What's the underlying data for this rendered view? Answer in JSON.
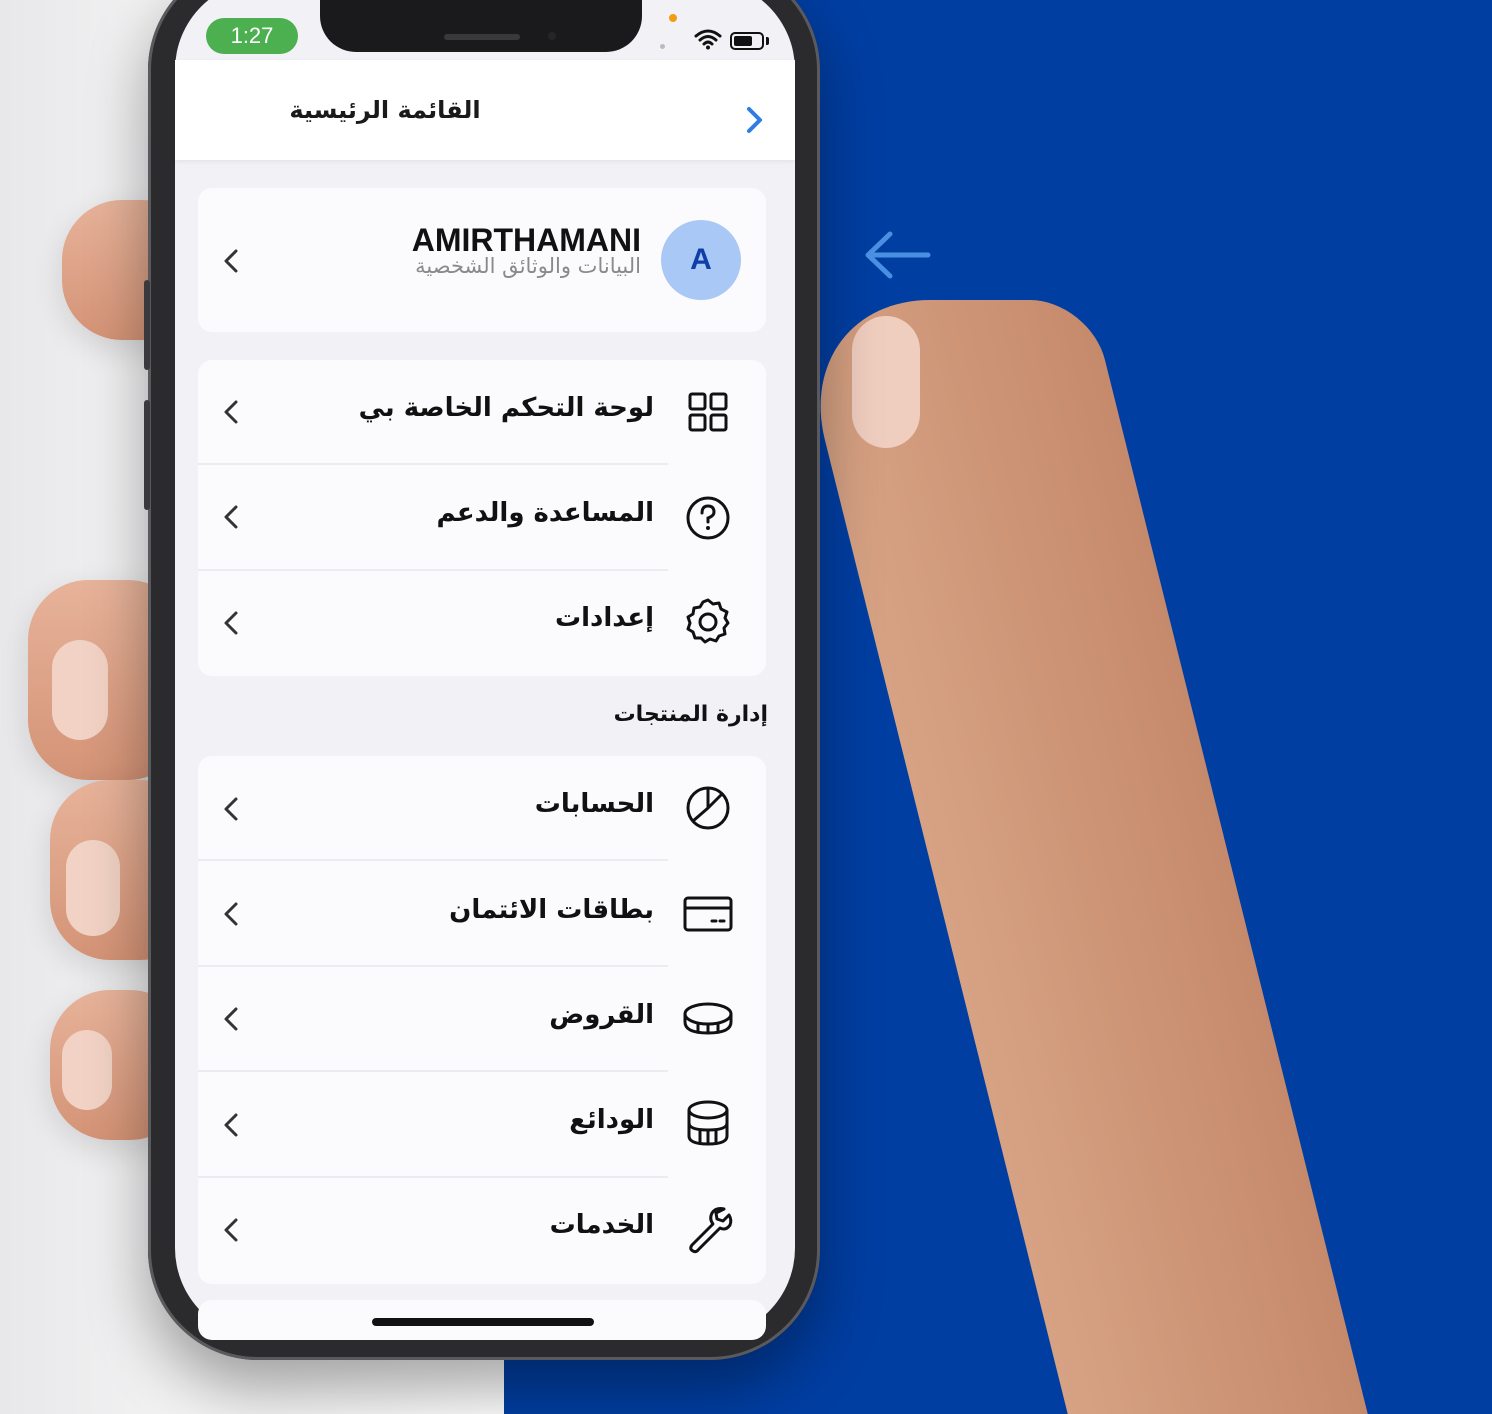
{
  "status_bar": {
    "time": "1:27"
  },
  "header": {
    "title": "القائمة الرئيسية"
  },
  "profile": {
    "initial": "A",
    "name": "AMIRTHAMANI",
    "subtitle": "البيانات والوثائق الشخصية"
  },
  "menu_group_1": [
    {
      "label": "لوحة التحكم الخاصة بي",
      "icon": "dashboard-grid-icon"
    },
    {
      "label": "المساعدة والدعم",
      "icon": "help-question-icon"
    },
    {
      "label": "إعدادات",
      "icon": "settings-gear-icon"
    }
  ],
  "section": {
    "title": "إدارة المنتجات"
  },
  "menu_group_2": [
    {
      "label": "الحسابات",
      "icon": "pie-chart-icon"
    },
    {
      "label": "بطاقات الائتمان",
      "icon": "credit-card-icon"
    },
    {
      "label": "القروض",
      "icon": "coin-icon"
    },
    {
      "label": "الودائع",
      "icon": "coin-stack-icon"
    },
    {
      "label": "الخدمات",
      "icon": "wrench-icon"
    }
  ],
  "colors": {
    "brand_blue": "#003ea2",
    "status_green": "#4caf50",
    "avatar_bg": "#a9c8f6",
    "accent_arrow": "#4a90e2"
  }
}
